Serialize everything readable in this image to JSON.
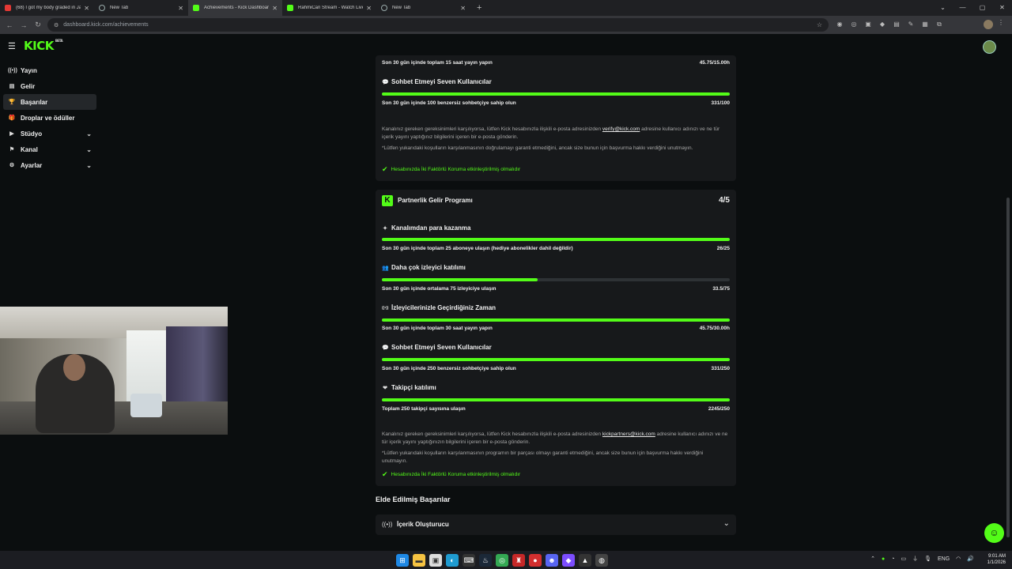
{
  "browser": {
    "tabs": [
      {
        "label": "(68) I got my body graded in Ja",
        "favicon": "yt"
      },
      {
        "label": "New Tab",
        "favicon": "gen"
      },
      {
        "label": "Achievements - Kick Dashboard",
        "favicon": "kick"
      },
      {
        "label": "RahmiCan Stream - Watch Live",
        "favicon": "kick"
      },
      {
        "label": "New Tab",
        "favicon": "gen"
      }
    ],
    "active_tab": 2,
    "url": "dashboard.kick.com/achievements",
    "new_tab_glyph": "+"
  },
  "header": {
    "logo_text": "KICK",
    "logo_badge": "BETA"
  },
  "sidebar": {
    "items": [
      {
        "label": "Yayın",
        "icon": "broadcast-icon",
        "glyph": "((•))"
      },
      {
        "label": "Gelir",
        "icon": "revenue-icon",
        "glyph": "▤"
      },
      {
        "label": "Başarılar",
        "icon": "trophy-icon",
        "glyph": "🏆"
      },
      {
        "label": "Droplar ve ödüller",
        "icon": "gift-icon",
        "glyph": "🎁"
      },
      {
        "label": "Stüdyo",
        "icon": "studio-icon",
        "glyph": "▶",
        "expandable": true
      },
      {
        "label": "Kanal",
        "icon": "channel-icon",
        "glyph": "⚑",
        "expandable": true
      },
      {
        "label": "Ayarlar",
        "icon": "settings-icon",
        "glyph": "⚙",
        "expandable": true
      }
    ],
    "active_index": 2
  },
  "card_top": {
    "first_req": "Son 30 gün içinde toplam 15 saat yayın yapın",
    "first_val": "45.75/15.00h",
    "chat_title": "Sohbet Etmeyi Seven Kullanıcılar",
    "chat_req": "Son 30 gün içinde 100 benzersiz sohbetçiye sahip olun",
    "chat_val": "331/100",
    "note1_pre": "Kanalınız gereken gereksinimleri karşılıyorsa, lütfen Kick hesabınızla ilişkili e-posta adresinizden",
    "note1_email": "verify@kick.com",
    "note1_post": "adresine kullanıcı adınızı ve ne tür içerik yayını yaptığınız bilgilerini içeren bir e-posta gönderin.",
    "note2": "*Lütfen yukarıdaki koşulların karşılanmasının doğrulamayı garanti etmediğini, ancak size bunun için başvurma hakkı verdiğini unutmayın.",
    "check": "Hesabınızda İki Faktörlü Koruma etkinleştirilmiş olmalıdır"
  },
  "card_partner": {
    "title": "Partnerlik Gelir Programı",
    "progress": "4/5",
    "rows": [
      {
        "title": "Kanalımdan para kazanma",
        "req": "Son 30 gün içinde toplam 25 aboneye ulaşın (hediye abonelikler dahil değildir)",
        "value": "26/25",
        "fill": 1.0,
        "icon": "sparkle-icon",
        "glyph": "✦"
      },
      {
        "title": "Daha çok izleyici katılımı",
        "req": "Son 30 gün içinde ortalama 75 izleyiciye ulaşın",
        "value": "33.5/75",
        "fill": 0.447,
        "icon": "users-icon",
        "glyph": "👥"
      },
      {
        "title": "İzleyicilerinizle Geçirdiğiniz Zaman",
        "req": "Son 30 gün içinde toplam 30 saat yayın yapın",
        "value": "45.75/30.00h",
        "fill": 1.0,
        "icon": "broadcast-icon",
        "glyph": "((•))"
      },
      {
        "title": "Sohbet Etmeyi Seven Kullanıcılar",
        "req": "Son 30 gün içinde 250 benzersiz sohbetçiye sahip olun",
        "value": "331/250",
        "fill": 1.0,
        "icon": "chat-icon",
        "glyph": "💬"
      },
      {
        "title": "Takipçi katılımı",
        "req": "Toplam 250 takipçi sayısına ulaşın",
        "value": "2245/250",
        "fill": 1.0,
        "icon": "heart-icon",
        "glyph": "❤"
      }
    ],
    "note1_pre": "Kanalınız gereken gereksinimleri karşılıyorsa, lütfen Kick hesabınızla ilişkili e-posta adresinizden",
    "note1_email": "kickpartners@kick.com",
    "note1_post": "adresine kullanıcı adınızı ve ne tür içerik yayını yaptığınızın bilgilerini içeren bir e-posta gönderin.",
    "note2": "*Lütfen yukarıdaki koşulların karşılanmasının programın bir parçası olmayı garanti etmediğini, ancak size bunun için başvurma hakkı verdiğini unutmayın.",
    "check": "Hesabınızda İki Faktörlü Koruma etkinleştirilmiş olmalıdır"
  },
  "achieved": {
    "heading": "Elde Edilmiş Başarılar",
    "accordion_label": "İçerik Oluşturucu"
  },
  "taskbar": {
    "lang": "ENG",
    "time": "9:01 AM",
    "date": "1/1/2026"
  },
  "colors": {
    "accent": "#53fc18",
    "bg": "#0b0e0f",
    "card": "#17191b"
  }
}
